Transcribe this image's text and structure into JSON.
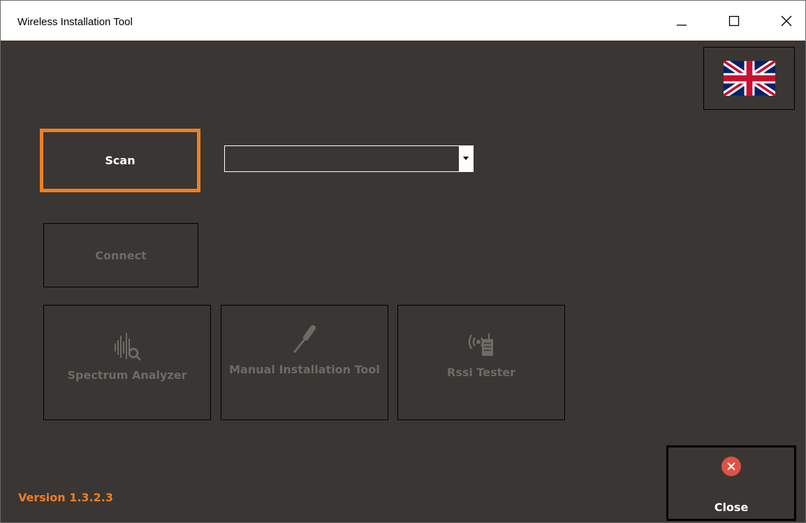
{
  "window": {
    "title": "Wireless Installation Tool",
    "controls": {
      "minimize_icon": "minimize-icon",
      "maximize_icon": "maximize-icon",
      "close_icon": "close-icon"
    }
  },
  "language_button": {
    "icon": "uk-flag-icon"
  },
  "scan": {
    "label": "Scan",
    "accent_color": "#f07f22"
  },
  "device_select": {
    "value": "",
    "icon": "chevron-down-icon"
  },
  "connect": {
    "label": "Connect"
  },
  "tools": [
    {
      "label": "Spectrum Analyzer",
      "icon": "spectrum-analyzer-icon"
    },
    {
      "label": "Manual Installation Tool",
      "icon": "screwdriver-icon"
    },
    {
      "label": "Rssi Tester",
      "icon": "rssi-tester-icon"
    }
  ],
  "close_button": {
    "label": "Close",
    "icon": "close-circle-icon",
    "icon_color": "#e05145"
  },
  "version": "Version 1.3.2.3",
  "colors": {
    "background": "#3a3633",
    "accent": "#f07f22",
    "disabled_text": "#6e6a66"
  }
}
